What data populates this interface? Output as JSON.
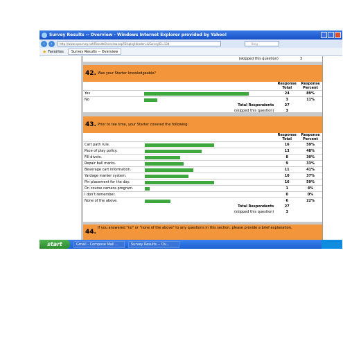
{
  "window": {
    "title": "Survey Results -- Overview - Windows Internet Explorer provided by Yahoo!"
  },
  "browser": {
    "url": "http://www.epsurvey.net/ResultsOverview.asp?DisplayHeader=&SurveyID=134",
    "search_placeholder": "Bing",
    "favorites_label": "Favorites",
    "tab_label": "Survey Results -- Overview"
  },
  "survey": {
    "prev_skipped": {
      "label": "(skipped this question)",
      "value": "3"
    },
    "q42": {
      "number": "42.",
      "text": "Was your Starter knowledgeable?",
      "col_total": "Response Total",
      "col_percent": "Response Percent",
      "rows": [
        {
          "label": "Yes",
          "total": "24",
          "percent": "89%",
          "fraction": 0.89
        },
        {
          "label": "No",
          "total": "3",
          "percent": "11%",
          "fraction": 0.11
        }
      ],
      "total_label": "Total Respondents",
      "total_value": "27",
      "skipped_label": "(skipped this question)",
      "skipped_value": "3"
    },
    "q43": {
      "number": "43.",
      "text": "Prior to tee time, your Starter covered the following:",
      "col_total": "Response Total",
      "col_percent": "Response Percent",
      "rows": [
        {
          "label": "Cart path rule.",
          "total": "16",
          "percent": "59%",
          "fraction": 0.59
        },
        {
          "label": "Pace of play policy.",
          "total": "13",
          "percent": "48%",
          "fraction": 0.48
        },
        {
          "label": "Fill divots.",
          "total": "8",
          "percent": "30%",
          "fraction": 0.3
        },
        {
          "label": "Repair ball marks.",
          "total": "9",
          "percent": "33%",
          "fraction": 0.33
        },
        {
          "label": "Beverage cart information.",
          "total": "11",
          "percent": "41%",
          "fraction": 0.41
        },
        {
          "label": "Yardage marker system.",
          "total": "10",
          "percent": "37%",
          "fraction": 0.37
        },
        {
          "label": "Pin placement for the day.",
          "total": "16",
          "percent": "59%",
          "fraction": 0.59
        },
        {
          "label": "On course camera program.",
          "total": "1",
          "percent": "4%",
          "fraction": 0.04
        },
        {
          "label": "I don't remember.",
          "total": "0",
          "percent": "0%",
          "fraction": 0.0
        },
        {
          "label": "None of the above.",
          "total": "6",
          "percent": "22%",
          "fraction": 0.22
        }
      ],
      "total_label": "Total Respondents",
      "total_value": "27",
      "skipped_label": "(skipped this question)",
      "skipped_value": "3"
    },
    "q44": {
      "number": "44.",
      "text": "If you answered \"no\" or \"none of the above\" to any questions in this section, please provide a brief explanation."
    }
  },
  "taskbar": {
    "start_label": "start",
    "tasks": [
      {
        "label": "Gmail - Compose Mail ..."
      },
      {
        "label": "Survey Results -- Ov..."
      }
    ]
  },
  "colors": {
    "header_orange": "#f3963b",
    "bar_green": "#3ea83e",
    "titlebar_blue": "#1650c8"
  }
}
